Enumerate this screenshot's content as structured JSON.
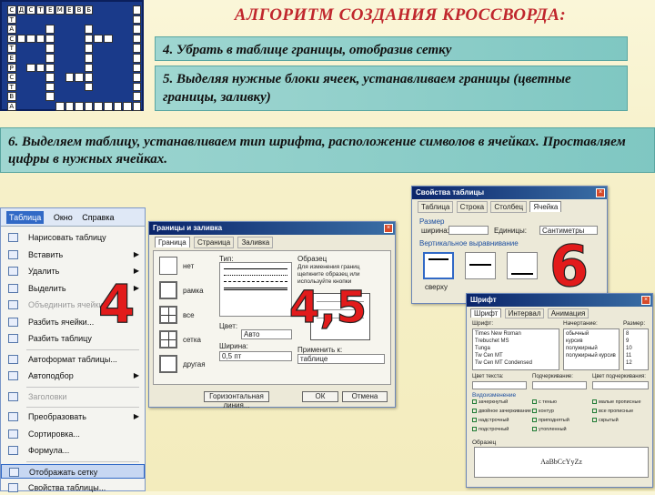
{
  "title": "АЛГОРИТМ СОЗДАНИЯ КРОССВОРДА:",
  "steps": {
    "s4": "4. Убрать в таблице границы, отобразив сетку",
    "s5": "5. Выделяя нужные блоки ячеек, устанавливаем границы (цветные границы, заливку)",
    "s6": "6. Выделяем таблицу, устанавливаем тип шрифта, расположение символов в ячейках. Проставляем цифры в нужных ячейках."
  },
  "crossword": {
    "row1": [
      "С",
      "Д",
      "С",
      "Т",
      "Е",
      "М",
      "Е",
      "В",
      "Б"
    ],
    "col_letters": [
      "Т",
      "А",
      "С",
      "Т",
      "Е",
      "Р",
      "С",
      "Т",
      "В",
      "А"
    ]
  },
  "labels": {
    "num4": "4",
    "num45": "4,5",
    "num6": "6"
  },
  "menu": {
    "bar": [
      "Таблица",
      "Окно",
      "Справка"
    ],
    "items": [
      {
        "label": "Нарисовать таблицу",
        "arrow": false,
        "gray": false
      },
      {
        "label": "Вставить",
        "arrow": true,
        "gray": false
      },
      {
        "label": "Удалить",
        "arrow": true,
        "gray": false
      },
      {
        "label": "Выделить",
        "arrow": true,
        "gray": false
      },
      {
        "label": "Объединить ячейки",
        "arrow": false,
        "gray": true
      },
      {
        "label": "Разбить ячейки...",
        "arrow": false,
        "gray": false
      },
      {
        "label": "Разбить таблицу",
        "arrow": false,
        "gray": false
      },
      {
        "label": "Автоформат таблицы...",
        "arrow": false,
        "gray": false
      },
      {
        "label": "Автоподбор",
        "arrow": true,
        "gray": false
      },
      {
        "label": "Заголовки",
        "arrow": false,
        "gray": true
      },
      {
        "label": "Преобразовать",
        "arrow": true,
        "gray": false
      },
      {
        "label": "Сортировка...",
        "arrow": false,
        "gray": false
      },
      {
        "label": "Формула...",
        "arrow": false,
        "gray": false
      },
      {
        "label": "Отображать сетку",
        "arrow": false,
        "gray": false
      },
      {
        "label": "Свойства таблицы...",
        "arrow": false,
        "gray": false
      }
    ]
  },
  "borders_dialog": {
    "title": "Границы и заливка",
    "tabs": [
      "Граница",
      "Страница",
      "Заливка"
    ],
    "types": [
      "нет",
      "рамка",
      "все",
      "сетка",
      "другая"
    ],
    "type_label": "Тип:",
    "color_label": "Цвет:",
    "color_value": "Авто",
    "width_label": "Ширина:",
    "width_value": "0,5 пт",
    "apply_label": "Применить к:",
    "apply_value": "таблице",
    "sample_label": "Образец",
    "sample_hint": "Для изменения границ щелкните образец или используйте кнопки",
    "panel_button": "Панель",
    "hline_button": "Горизонтальная линия...",
    "ok": "ОК",
    "cancel": "Отмена"
  },
  "props_dialog": {
    "title": "Свойства таблицы",
    "tabs": [
      "Таблица",
      "Строка",
      "Столбец",
      "Ячейка"
    ],
    "size_label": "Размер",
    "width_label": "ширина:",
    "unit_label": "Единицы:",
    "unit_value": "Сантиметры",
    "valign_label": "Вертикальное выравнивание",
    "valign_value": "сверху"
  },
  "font_dialog": {
    "title": "Шрифт",
    "tabs": [
      "Шрифт",
      "Интервал",
      "Анимация"
    ],
    "font_label": "Шрифт:",
    "style_label": "Начертание:",
    "size_label": "Размер:",
    "fonts": [
      "Times New Roman",
      "Trebuchet MS",
      "Tunga",
      "Tw Cen MT",
      "Tw Cen MT Condensed"
    ],
    "styles": [
      "обычный",
      "курсив",
      "полужирный",
      "полужирный курсив"
    ],
    "sizes": [
      "8",
      "9",
      "10",
      "11",
      "12"
    ],
    "color_label": "Цвет текста:",
    "underline_label": "Подчеркивание:",
    "underline_color_label": "Цвет подчеркивания:",
    "effects_label": "Видоизменение",
    "effects": [
      "зачеркнутый",
      "двойное зачеркивание",
      "надстрочный",
      "подстрочный",
      "с тенью",
      "контур",
      "приподнятый",
      "утопленный",
      "малые прописные",
      "все прописные",
      "скрытый"
    ],
    "sample_label": "Образец",
    "sample_text": "AaBbCcYyZz"
  }
}
